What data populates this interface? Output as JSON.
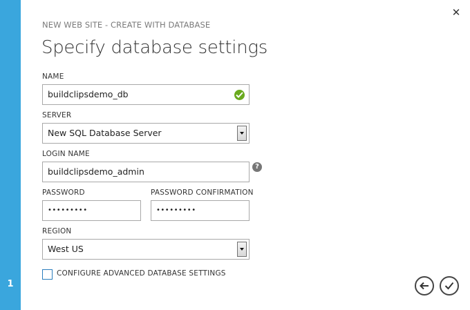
{
  "wizard": {
    "step_number": "1",
    "breadcrumb": "NEW WEB SITE - CREATE WITH DATABASE",
    "title": "Specify database settings",
    "close_icon": "close-icon",
    "accent_color": "#3aa6dd"
  },
  "form": {
    "name_label": "NAME",
    "name_value": "buildclipsdemo_db",
    "server_label": "SERVER",
    "server_value": "New SQL Database Server",
    "login_label": "LOGIN NAME",
    "login_value": "buildclipsdemo_admin",
    "password_label": "PASSWORD",
    "password_value": "•••••••••",
    "password_confirm_label": "PASSWORD CONFIRMATION",
    "password_confirm_value": "•••••••••",
    "region_label": "REGION",
    "region_value": "West US",
    "advanced_label": "CONFIGURE ADVANCED DATABASE SETTINGS",
    "advanced_checked": false,
    "help_glyph": "?"
  },
  "footer": {
    "back_icon": "arrow-left-icon",
    "finish_icon": "checkmark-icon"
  }
}
